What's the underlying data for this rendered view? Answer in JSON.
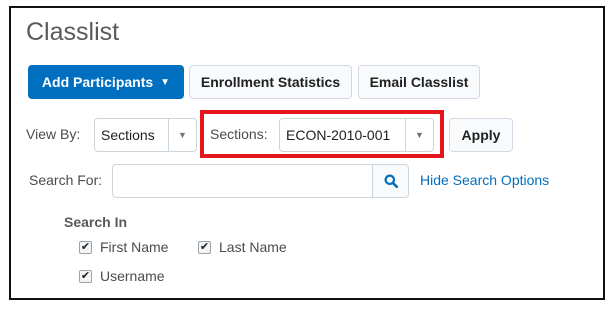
{
  "page": {
    "title": "Classlist"
  },
  "toolbar": {
    "add_participants": "Add Participants",
    "add_caret": "▼",
    "enrollment_statistics": "Enrollment Statistics",
    "email_classlist": "Email Classlist"
  },
  "filters": {
    "view_by_label": "View By:",
    "view_by_value": "Sections",
    "sections_label": "Sections:",
    "sections_value": "ECON-2010-001",
    "dropdown_arrow": "▼",
    "apply": "Apply"
  },
  "search": {
    "label": "Search For:",
    "value": "",
    "hide_options": "Hide Search Options"
  },
  "search_in": {
    "heading": "Search In",
    "check_mark": "✔",
    "options": [
      {
        "label": "First Name",
        "checked": true
      },
      {
        "label": "Last Name",
        "checked": true
      },
      {
        "label": "Username",
        "checked": true
      }
    ]
  },
  "colors": {
    "primary": "#006fbf",
    "highlight": "#e4161b",
    "link": "#006fbf"
  },
  "icons": [
    "search-icon",
    "chevron-down-icon",
    "checkbox-checked-icon"
  ]
}
